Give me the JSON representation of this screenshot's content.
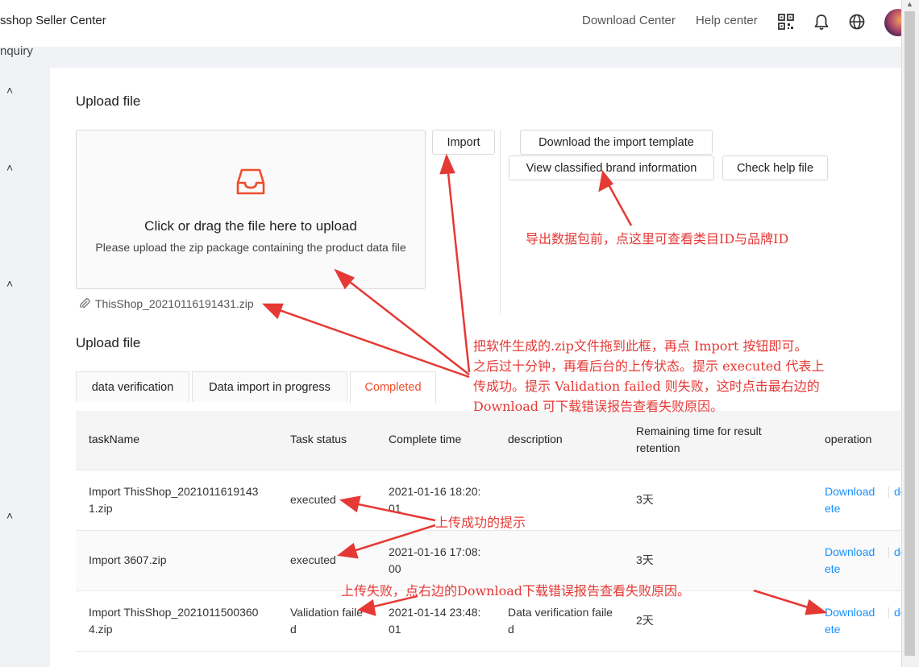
{
  "header": {
    "app_title": "sshop Seller Center",
    "nav": [
      "Download Center",
      "Help center"
    ],
    "icons": [
      "qrcode-icon",
      "bell-icon",
      "globe-icon"
    ],
    "page_subtitle": "nquiry"
  },
  "upload": {
    "title": "Upload file",
    "drop_main": "Click or drag the file here to upload",
    "drop_hint": "Please upload the zip package containing the product data file",
    "uploaded_file": "ThisShop_20210116191431.zip"
  },
  "buttons": {
    "import": "Import",
    "download_template": "Download the import template",
    "view_brand": "View classified brand information",
    "check_help": "Check help file"
  },
  "records": {
    "title": "Upload file",
    "tabs": [
      "data verification",
      "Data import in progress",
      "Completed"
    ],
    "active_tab": 2,
    "columns": [
      "taskName",
      "Task status",
      "Complete time",
      "description",
      "Remaining time for result retention",
      "operation"
    ],
    "rows": [
      {
        "task": "Import ThisShop_20210116191431.zip",
        "status": "executed",
        "time": "2021-01-16 18:20:01",
        "description": "",
        "remaining": "3天",
        "op1": "Download",
        "op2": "delete"
      },
      {
        "task": "Import 3607.zip",
        "status": "executed",
        "time": "2021-01-16 17:08:00",
        "description": "",
        "remaining": "3天",
        "op1": "Download",
        "op2": "delete"
      },
      {
        "task": "Import ThisShop_20210115003604.zip",
        "status": "Validation failed",
        "time": "2021-01-14 23:48:01",
        "description": "Data verification failed",
        "remaining": "2天",
        "op1": "Download",
        "op2": "delete"
      }
    ]
  },
  "annotations": {
    "brand_note": "导出数据包前，点这里可查看类目ID与品牌ID",
    "main_note": [
      "把软件生成的.zip文件拖到此框，再点 Import 按钮即可。",
      "之后过十分钟，再看后台的上传状态。提示 executed 代表上",
      "传成功。提示 Validation failed 则失败，这时点击最右边的",
      "Download 可下载错误报告查看失败原因。"
    ],
    "success_note": "上传成功的提示",
    "fail_note": "上传失败，点右边的Download下载错误报告查看失败原因。"
  },
  "colors": {
    "accent": "#ee4d2d",
    "link": "#1890ff",
    "annotation": "#e53935"
  }
}
